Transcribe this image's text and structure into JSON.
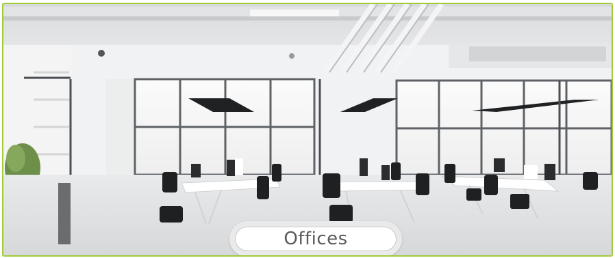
{
  "card": {
    "label": "Offices",
    "border_color": "#9fcc3b"
  },
  "image": {
    "subject": "open-plan-office-interior-photo"
  }
}
